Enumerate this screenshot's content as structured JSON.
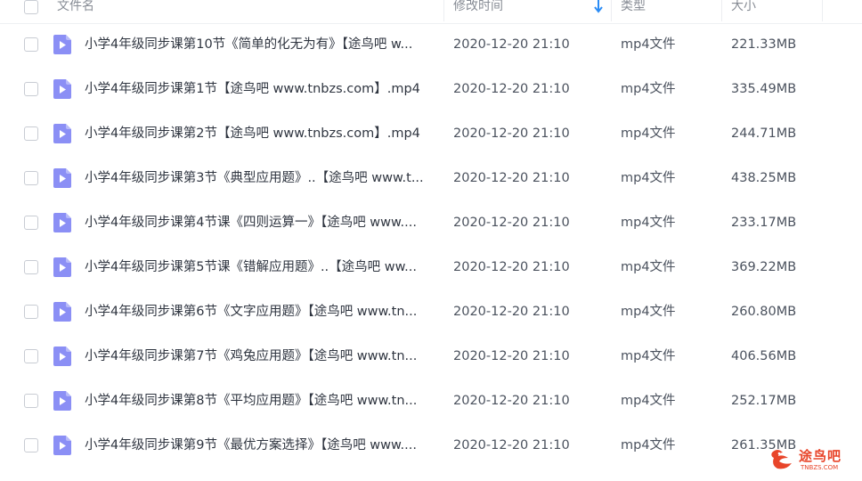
{
  "header": {
    "name_label": "文件名",
    "modified_label": "修改时间",
    "type_label": "类型",
    "size_label": "大小"
  },
  "files": [
    {
      "name": "小学4年级同步课第10节《简单的化无为有》【途鸟吧 w...",
      "date": "2020-12-20 21:10",
      "type": "mp4文件",
      "size": "221.33MB"
    },
    {
      "name": "小学4年级同步课第1节【途鸟吧 www.tnbzs.com】.mp4",
      "date": "2020-12-20 21:10",
      "type": "mp4文件",
      "size": "335.49MB"
    },
    {
      "name": "小学4年级同步课第2节【途鸟吧 www.tnbzs.com】.mp4",
      "date": "2020-12-20 21:10",
      "type": "mp4文件",
      "size": "244.71MB"
    },
    {
      "name": "小学4年级同步课第3节《典型应用题》..【途鸟吧 www.t...",
      "date": "2020-12-20 21:10",
      "type": "mp4文件",
      "size": "438.25MB"
    },
    {
      "name": "小学4年级同步课第4节课《四则运算一》【途鸟吧 www....",
      "date": "2020-12-20 21:10",
      "type": "mp4文件",
      "size": "233.17MB"
    },
    {
      "name": "小学4年级同步课第5节课《错解应用题》..【途鸟吧 ww...",
      "date": "2020-12-20 21:10",
      "type": "mp4文件",
      "size": "369.22MB"
    },
    {
      "name": "小学4年级同步课第6节《文字应用题》【途鸟吧 www.tn...",
      "date": "2020-12-20 21:10",
      "type": "mp4文件",
      "size": "260.80MB"
    },
    {
      "name": "小学4年级同步课第7节《鸡兔应用题》【途鸟吧 www.tn...",
      "date": "2020-12-20 21:10",
      "type": "mp4文件",
      "size": "406.56MB"
    },
    {
      "name": "小学4年级同步课第8节《平均应用题》【途鸟吧 www.tn...",
      "date": "2020-12-20 21:10",
      "type": "mp4文件",
      "size": "252.17MB"
    },
    {
      "name": "小学4年级同步课第9节《最优方案选择》【途鸟吧 www....",
      "date": "2020-12-20 21:10",
      "type": "mp4文件",
      "size": "261.35MB"
    }
  ],
  "watermark": {
    "text": "途鸟吧",
    "sub": "TNBZS.COM"
  },
  "colors": {
    "video_icon": "#8b8ff5",
    "sort_arrow": "#2b8cf5",
    "watermark": "#e8452a"
  },
  "icons": {
    "file_type": "video-file-icon",
    "sort": "sort-down-arrow-icon"
  }
}
